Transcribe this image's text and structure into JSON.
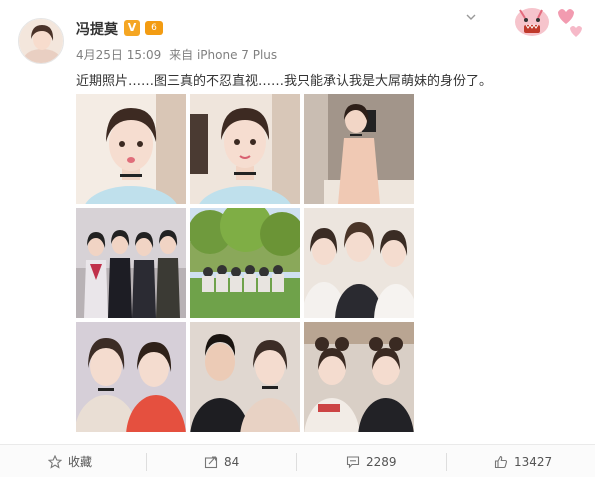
{
  "post": {
    "username": "冯提莫",
    "verified_badge": "V",
    "level_badge": "6",
    "date": "4月25日 15:09",
    "source": "来自 iPhone 7 Plus",
    "text": "近期照片……图三真的不忍直视……我只能承认我是大屌萌妹的身份了。",
    "photos_count": 9
  },
  "actions": {
    "favorite_label": "收藏",
    "repost_count": "84",
    "comment_count": "2289",
    "like_count": "13427"
  },
  "colors": {
    "accent": "#f5a623",
    "text": "#333333",
    "muted": "#808080"
  }
}
